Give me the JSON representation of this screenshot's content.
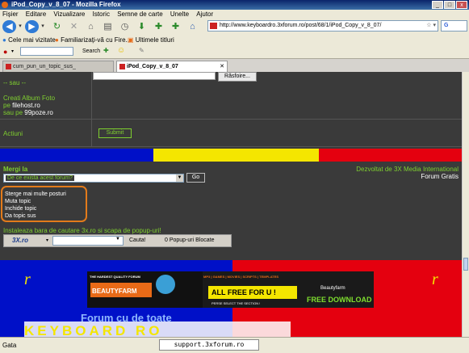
{
  "window": {
    "title": "iPod_Copy_v_8_07 - Mozilla Firefox"
  },
  "menu": [
    "Fișier",
    "Editare",
    "Vizualizare",
    "Istoric",
    "Semne de carte",
    "Unelte",
    "Ajutor"
  ],
  "address": {
    "url": "http://www.keyboardro.3xforum.ro/post/68/1/iPod_Copy_v_8_07/"
  },
  "search": {
    "label": "G"
  },
  "bookmarks": [
    {
      "label": "Cele mai vizitate"
    },
    {
      "label": "Familiarizați-vă cu Fire..."
    },
    {
      "label": "Ultimele titluri"
    }
  ],
  "toolbar2": {
    "search_label": "Search"
  },
  "tabs": [
    {
      "label": "cum_pun_un_topic_sus_"
    },
    {
      "label": "iPod_Copy_v_8_07"
    }
  ],
  "page": {
    "browse_button": "Răsfoire...",
    "or_label": "-- sau --",
    "album_label": "Creati Album Foto",
    "pe_label": "pe",
    "filehost": "filehost.ro",
    "sau_pe_label": "sau pe",
    "poze": "99poze.ro",
    "actiuni_label": "Actiuni",
    "submit_button": "Submit",
    "merge_label": "Mergi la",
    "forum_select": "De ce exista acest forum?",
    "go_button": "Go",
    "dev_text": "Dezvoltat de 3X Media International",
    "forum_gratis": "Forum Gratis",
    "menu_items": [
      "Sterge mai multe posturi",
      "Muta topic",
      "Inchide topic",
      "Da topic sus"
    ],
    "install_text": "Instaleaza bara de cautare 3x.ro si scapa de popup-uri!",
    "search_logo": "3X.ro",
    "cauta_button": "Cauta!",
    "popup_blocked": "0 Popup-uri Blocate",
    "banner_text": "Forum cu de toate",
    "banner_logo": "KEYBOARD RO",
    "ad_left_top": "THE HARDEST QUALITY FORUM",
    "ad_left_brand": "BEAUTYFARM",
    "ad_right_top": "MP3 | GAMES | MOVIES | SCRIPTS | TEMPLATES",
    "ad_right_main": "ALL FREE FOR U !",
    "ad_right_sub": "PERSE SELECT THE SECTION !",
    "ad_right_brand": "Beautyfarm",
    "ad_right_download": "FREE DOWNLOAD"
  },
  "status": {
    "text": "Gata",
    "tooltip": "support.3xforum.ro"
  },
  "colors": {
    "accent_green": "#7fcf2f",
    "panel_bg": "#3a3a3a",
    "flag_blue": "#0010c8",
    "flag_yellow": "#f4e600",
    "flag_red": "#e4000f",
    "highlight_orange": "#e37b1b"
  }
}
